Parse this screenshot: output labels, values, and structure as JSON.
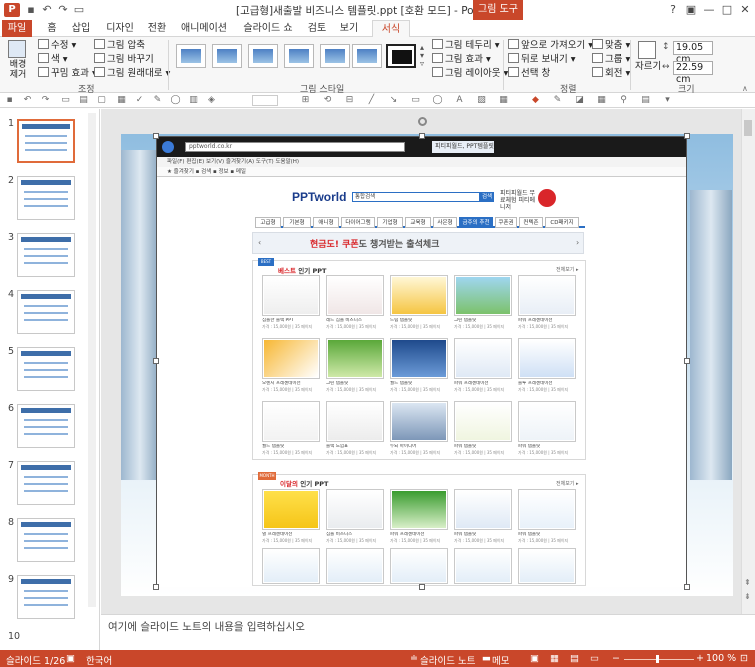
{
  "window": {
    "title": "[고급형]새출발 비즈니스 템플릿.ppt [호환 모드] - PowerPoint",
    "context_tab": "그림 도구",
    "app_icon": "P",
    "controls": [
      "?",
      "▣",
      "—",
      "□",
      "✕"
    ]
  },
  "quick_access": [
    "save-icon",
    "undo-icon",
    "redo-icon",
    "present-icon",
    "customize-icon"
  ],
  "tabs": [
    "파일",
    "홈",
    "삽입",
    "디자인",
    "전환",
    "애니메이션",
    "슬라이드 쇼",
    "검토",
    "보기",
    "서식"
  ],
  "ribbon": {
    "adjust": {
      "remove_bg": "배경\n제거",
      "corrections": "수정",
      "color": "색",
      "artistic": "꾸밈 효과",
      "compress": "그림 압축",
      "change": "그림 바꾸기",
      "reset": "그림 원래대로",
      "group_label": "조정"
    },
    "styles": {
      "group_label": "그림 스타일",
      "border": "그림 테두리",
      "effects": "그림 효과",
      "layout": "그림 레이아웃"
    },
    "arrange": {
      "bring_forward": "앞으로 가져오기",
      "send_backward": "뒤로 보내기",
      "selection_pane": "선택 창",
      "align": "맞춤",
      "group": "그룹",
      "rotate": "회전",
      "group_label": "정렬"
    },
    "size": {
      "crop": "자르기",
      "height": "19.05 cm",
      "width": "22.59 cm",
      "group_label": "크기"
    }
  },
  "thumbnails": [
    {
      "num": "1",
      "selected": true
    },
    {
      "num": "2",
      "selected": false
    },
    {
      "num": "3",
      "selected": false
    },
    {
      "num": "4",
      "selected": false
    },
    {
      "num": "5",
      "selected": false
    },
    {
      "num": "6",
      "selected": false
    },
    {
      "num": "7",
      "selected": false
    },
    {
      "num": "8",
      "selected": false
    },
    {
      "num": "9",
      "selected": false
    },
    {
      "num": "10",
      "selected": false
    }
  ],
  "browser": {
    "address": "pptworld.co.kr",
    "tab_title": "피티피월드, PPT템플릿 전문",
    "menu": "파일(F)  편집(E)  보기(V)  즐겨찾기(A)  도구(T)  도움말(H)",
    "favorites": "★ 즐겨찾기  ▪ 검색  ▪ 정보  ▪ 메일"
  },
  "site": {
    "logo": "PPTworld",
    "search_placeholder": "통합검색",
    "search_button": "검색",
    "promo": "피티피월드 무료체험 피티메니저",
    "nav": [
      "고급형",
      "기본형",
      "애니형",
      "다이어그램",
      "기업형",
      "교육형",
      "사은형",
      "금주의 추천",
      "쿠폰권",
      "컨텍존",
      "CD패키지"
    ],
    "banner_prefix": "현금도! 쿠폰",
    "banner_suffix": "도 챙겨받는 출석체크",
    "best_title_a": "베스트",
    "best_title_b": " 인기 PPT",
    "month_title_a": "이달의",
    "month_title_b": " 인기 PPT",
    "more": "전체보기 ▸",
    "best_captions": [
      "심플한 블랙 PPT",
      "레드 심플 비즈니스",
      "드림 템플릿",
      "그린 템플릿",
      "파워 프레젠테이션",
      "오렌지 프레젠테이션",
      "그린 템플릿",
      "월드 템플릿",
      "파워 프레젠테이션",
      "블루 프레젠테이션",
      "월드 템플릿",
      "블랙 느낌표",
      "두뇌 아이디어",
      "파워 템플릿",
      "파워 템플릿"
    ],
    "month_captions": [
      "별 프레젠테이션",
      "심플 비즈니스",
      "파워 프레젠테이션",
      "파워 템플릿",
      "파워 템플릿"
    ],
    "price": "가격 : 15,000원 | 35 페이지"
  },
  "notes_placeholder": "여기에 슬라이드 노트의 내용을 입력하십시오",
  "status": {
    "slide": "슬라이드 1/26",
    "language": "한국어",
    "notes": "슬라이드 노트",
    "comments": "메모",
    "zoom": "100 %"
  },
  "colors": {
    "accent": "#c9472a",
    "site_blue": "#2b6fc4",
    "site_red": "#d9262a"
  }
}
